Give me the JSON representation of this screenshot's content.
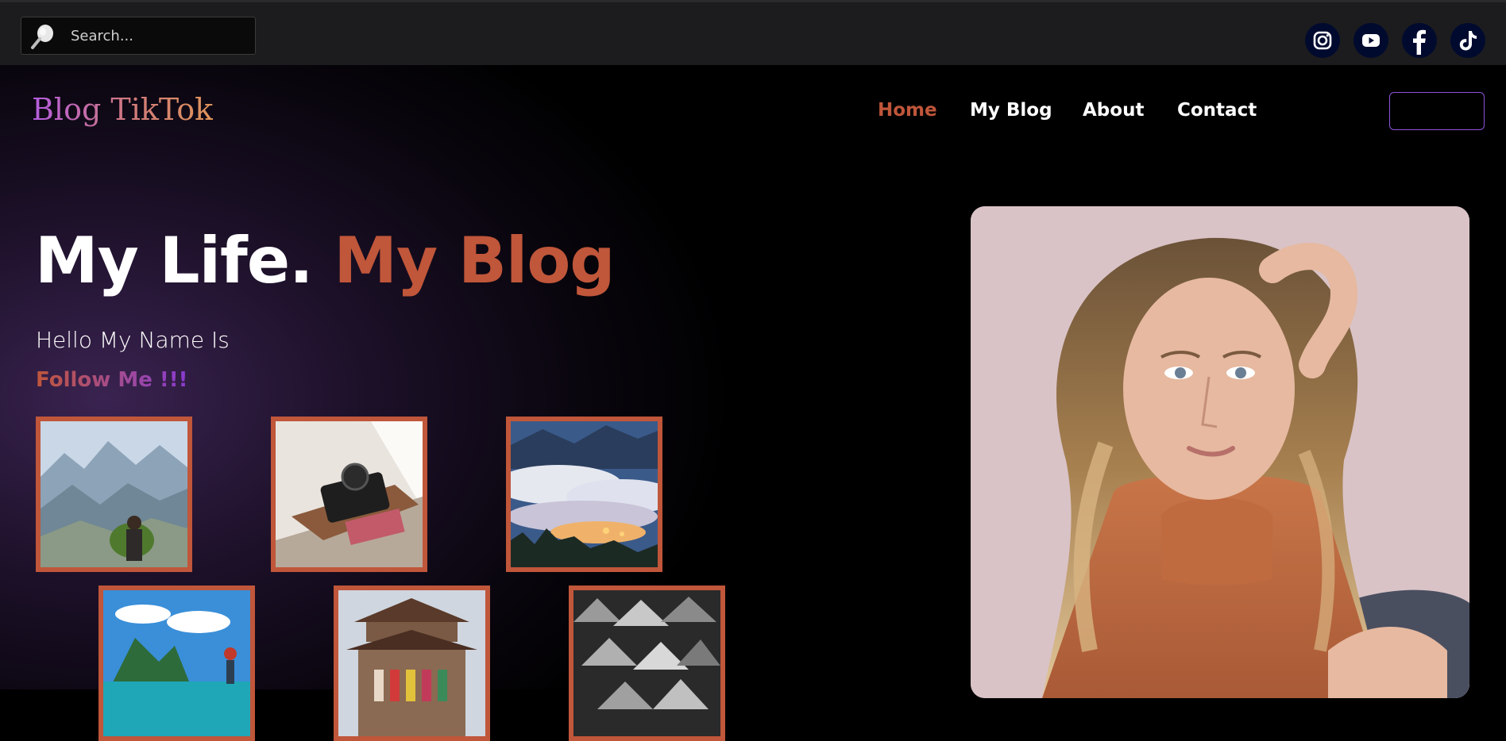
{
  "search": {
    "placeholder": "Search..."
  },
  "social": [
    "instagram-icon",
    "youtube-icon",
    "facebook-icon",
    "tiktok-icon"
  ],
  "brand": {
    "logo": "Blog TikTok"
  },
  "nav": {
    "items": [
      "Home",
      "My Blog",
      "About",
      "Contact"
    ],
    "active": "Home"
  },
  "hero": {
    "title_white": "My Life.",
    "title_accent": "My Blog",
    "hello": "Hello My Name Is",
    "follow": "Follow Me !!!"
  },
  "gallery": [
    "mountain-photo",
    "camera-photo",
    "foggy-valley-photo",
    "beach-photo",
    "temple-photo",
    "conical-hats-photo"
  ],
  "colors": {
    "accent": "#c0563a",
    "purple": "#8a55d6",
    "topbar": "#1c1c1e"
  }
}
